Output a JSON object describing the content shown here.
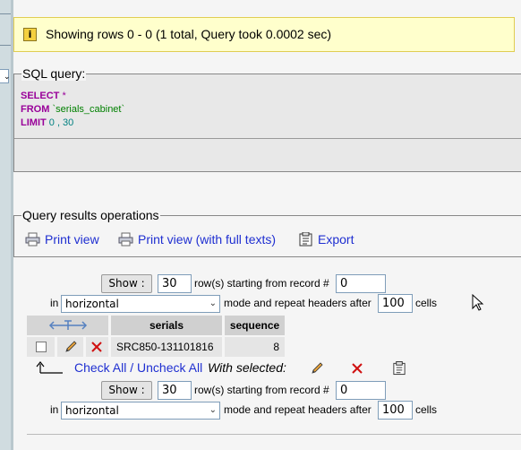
{
  "notice": {
    "text": "Showing rows 0 - 0 (1 total, Query took 0.0002 sec)"
  },
  "sql": {
    "legend": "SQL query:",
    "select_kw": "SELECT",
    "select_rest": " *",
    "from_kw": "FROM",
    "from_table": " `serials_cabinet`",
    "limit_kw": "LIMIT",
    "limit_vals": " 0 , 30"
  },
  "ops": {
    "legend": "Query results operations",
    "print_view": "Print view",
    "print_view_full": "Print view (with full texts)",
    "export": "Export"
  },
  "nav": {
    "show_label": "Show :",
    "rows_value": "30",
    "rows_text": "row(s) starting from record #",
    "start_value": "0",
    "in_text": "in",
    "mode_value": "horizontal",
    "mode_text": "mode and repeat headers after",
    "headers_value": "100",
    "cells_text": "cells"
  },
  "table": {
    "columns": [
      "serials",
      "sequence"
    ],
    "rows": [
      {
        "serials": "SRC850-131101816",
        "sequence": "8"
      }
    ]
  },
  "bulk": {
    "check_all": "Check All",
    "separator": " / ",
    "uncheck_all": "Uncheck All",
    "with_selected": "With selected:"
  },
  "colors": {
    "link": "#1f2fd1",
    "notice_bg": "#ffffcc",
    "keyword": "#990099",
    "table_name": "#008000"
  },
  "icons": [
    "info-icon",
    "print-icon",
    "export-icon",
    "pencil-icon",
    "delete-icon",
    "sort-arrows-icon"
  ]
}
